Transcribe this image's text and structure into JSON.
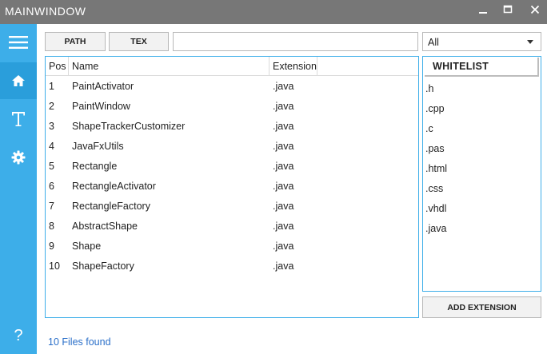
{
  "window": {
    "title": "MAINWINDOW",
    "minimize_glyph": "🗕",
    "maximize_glyph": "☐",
    "close_glyph": "✕"
  },
  "sidebar": {
    "color": "#3daee9",
    "items": [
      {
        "icon": "hamburger-menu-icon"
      },
      {
        "icon": "home-icon",
        "active": true
      },
      {
        "icon": "text-t-icon"
      },
      {
        "icon": "gear-icon"
      },
      {
        "icon": "help-question-icon",
        "glyph": "?"
      }
    ]
  },
  "toolbar": {
    "path_label": "PATH",
    "tex_label": "TEX",
    "input_value": "",
    "filter_selected": "All"
  },
  "table": {
    "columns": [
      "Pos",
      "Name",
      "Extension"
    ],
    "rows": [
      {
        "pos": "1",
        "name": "PaintActivator",
        "ext": ".java"
      },
      {
        "pos": "2",
        "name": "PaintWindow",
        "ext": ".java"
      },
      {
        "pos": "3",
        "name": "ShapeTrackerCustomizer",
        "ext": ".java"
      },
      {
        "pos": "4",
        "name": "JavaFxUtils",
        "ext": ".java"
      },
      {
        "pos": "5",
        "name": "Rectangle",
        "ext": ".java"
      },
      {
        "pos": "6",
        "name": "RectangleActivator",
        "ext": ".java"
      },
      {
        "pos": "7",
        "name": "RectangleFactory",
        "ext": ".java"
      },
      {
        "pos": "8",
        "name": "AbstractShape",
        "ext": ".java"
      },
      {
        "pos": "9",
        "name": "Shape",
        "ext": ".java"
      },
      {
        "pos": "10",
        "name": "ShapeFactory",
        "ext": ".java"
      }
    ]
  },
  "whitelist": {
    "header": "WHITELIST",
    "items": [
      ".h",
      ".cpp",
      ".c",
      ".pas",
      ".html",
      ".css",
      ".vhdl",
      ".java"
    ]
  },
  "add_extension_label": "ADD EXTENSION",
  "status": {
    "text": "10 Files found",
    "color": "#2a6fc9"
  }
}
